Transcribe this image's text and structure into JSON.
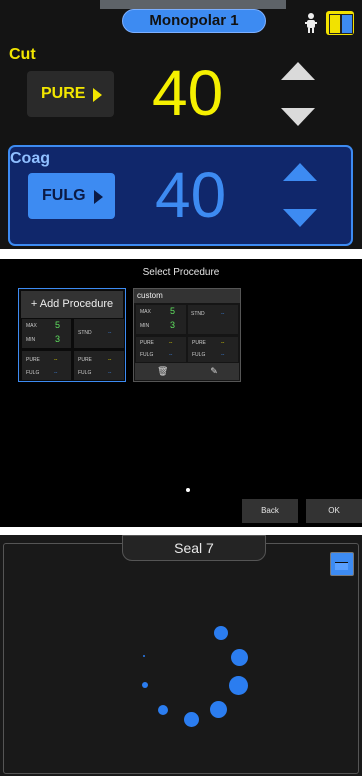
{
  "panel1": {
    "title": "Monopolar 1",
    "cut": {
      "label": "Cut",
      "mode": "PURE",
      "value": "40"
    },
    "coag": {
      "label": "Coag",
      "mode": "FULG",
      "value": "40"
    }
  },
  "panel2": {
    "title": "Select Procedure",
    "add_card": {
      "title": "+ Add Procedure",
      "max_label": "MAX",
      "max_value": "5",
      "min_label": "MIN",
      "min_value": "3",
      "stnd_label": "STND",
      "stnd_value": "--",
      "pure_label": "PURE",
      "pure_value": "--",
      "pure2_label": "PURE",
      "pure2_value": "--",
      "fulg_label": "FULG",
      "fulg_value": "--",
      "fulg2_label": "FULG",
      "fulg2_value": "--"
    },
    "custom_card": {
      "title": "custom",
      "max_label": "MAX",
      "max_value": "5",
      "min_label": "MIN",
      "min_value": "3",
      "stnd_label": "STND",
      "stnd_value": "--",
      "pure_label": "PURE",
      "pure_value": "--",
      "pure2_label": "PURE",
      "pure2_value": "--",
      "fulg_label": "FULG",
      "fulg_value": "--",
      "fulg2_label": "FULG",
      "fulg2_value": "--"
    },
    "back_label": "Back",
    "ok_label": "OK"
  },
  "panel3": {
    "title": "Seal 7"
  },
  "colors": {
    "cut_yellow": "#f5f000",
    "coag_blue": "#3d8bf2",
    "background": "#141414"
  }
}
